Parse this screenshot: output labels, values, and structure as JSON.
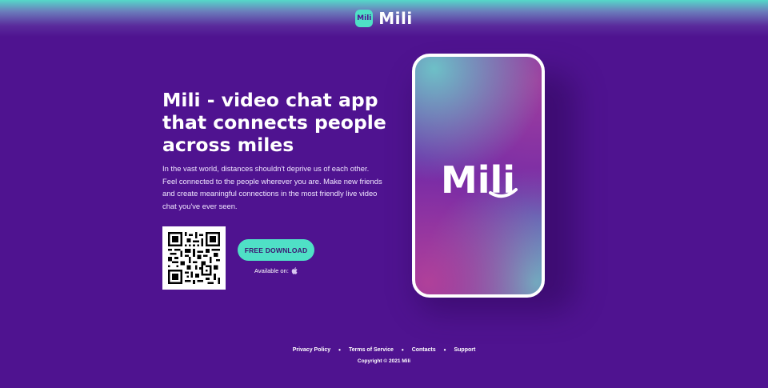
{
  "header": {
    "logo_badge": "Mili",
    "logo_text": "Mili"
  },
  "hero": {
    "title": "Mili - video chat app that connects people across miles",
    "description": "In the vast world, distances shouldn't deprive us of each other. Feel connected to the people wherever you are. Make new friends and create meaningful connections in the most friendly live video chat you've ever seen."
  },
  "cta": {
    "download_label": "FREE DOWNLOAD",
    "available_label": "Available on:",
    "platform_icon": "apple-icon"
  },
  "phone": {
    "logo_text": "Mili"
  },
  "footer": {
    "links": [
      "Privacy Policy",
      "Terms of Service",
      "Contacts",
      "Support"
    ],
    "copyright": "Copyright © 2021 Mili"
  },
  "colors": {
    "background": "#4f1390",
    "accent": "#4fe0c6",
    "text": "#ffffff"
  }
}
